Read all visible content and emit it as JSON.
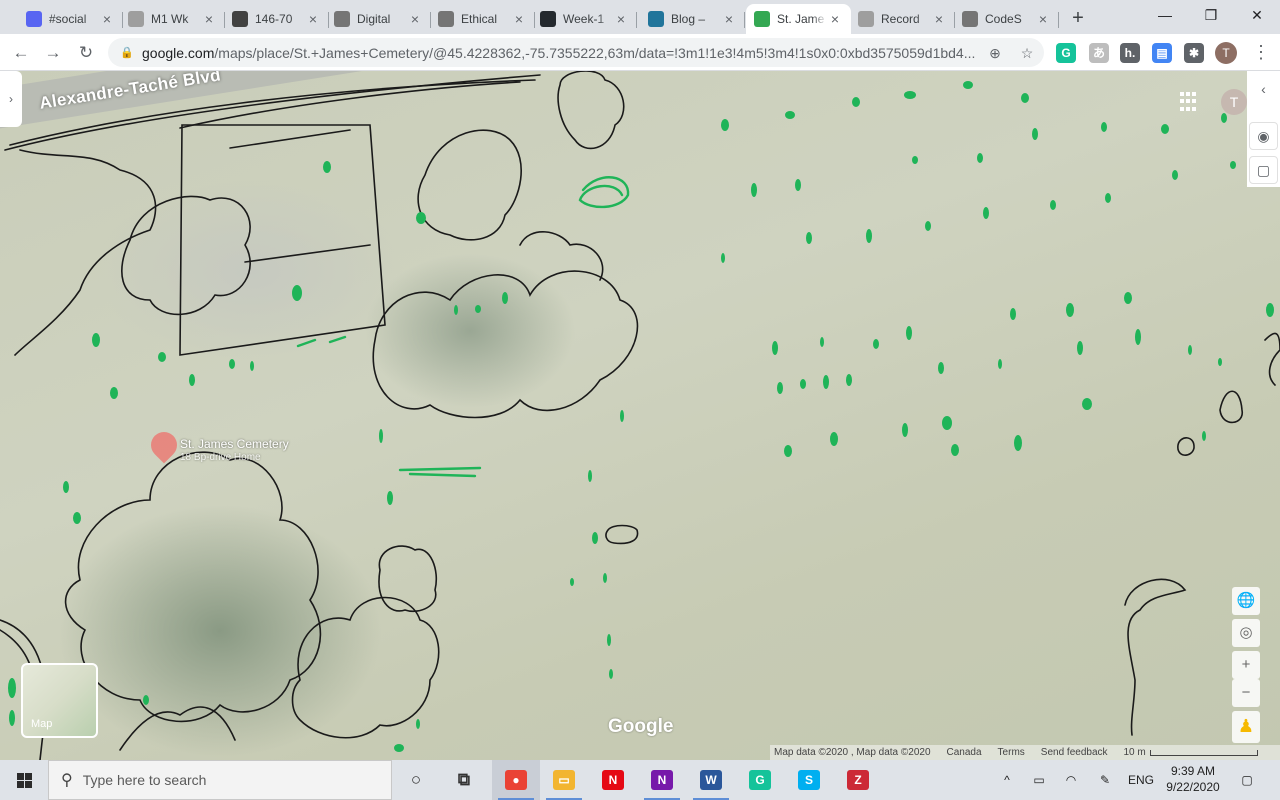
{
  "browser": {
    "tabs": [
      {
        "title": "#social",
        "favicon_color": "#5865f2",
        "active": false
      },
      {
        "title": "M1 Wk",
        "favicon_color": "#9e9e9e",
        "active": false
      },
      {
        "title": "146-70",
        "favicon_color": "#424242",
        "active": false
      },
      {
        "title": "Digital",
        "favicon_color": "#757575",
        "active": false
      },
      {
        "title": "Ethical",
        "favicon_color": "#757575",
        "active": false
      },
      {
        "title": "Week-1",
        "favicon_color": "#24292e",
        "active": false
      },
      {
        "title": "Blog –",
        "favicon_color": "#21759b",
        "active": false
      },
      {
        "title": "St. Jame",
        "favicon_color": "#34a853",
        "active": true
      },
      {
        "title": "Record",
        "favicon_color": "#9e9e9e",
        "active": false
      },
      {
        "title": "CodeS",
        "favicon_color": "#757575",
        "active": false
      }
    ],
    "new_tab_label": "+",
    "window_controls": {
      "minimize": "—",
      "restore": "❐",
      "close": "✕"
    },
    "nav": {
      "back": "←",
      "forward": "→",
      "reload": "↻"
    },
    "url_host": "google.com",
    "url_rest": "/maps/place/St.+James+Cemetery/@45.4228362,-75.7355222,63m/data=!3m1!1e3!4m5!3m4!1s0x0:0xbd3575059d1bd4...",
    "profile_initial": "T",
    "extensions": [
      {
        "name": "grammarly-icon",
        "label": "G",
        "color": "#15c39a"
      },
      {
        "name": "translate-icon",
        "label": "あ",
        "color": "#bdbdbd"
      },
      {
        "name": "hypothesis-icon",
        "label": "h.",
        "color": "#5f6368"
      },
      {
        "name": "docs-icon",
        "label": "▤",
        "color": "#4285f4"
      },
      {
        "name": "puzzle-icon",
        "label": "✱",
        "color": "#5f6368"
      }
    ]
  },
  "map": {
    "street_label": "Alexandre-Taché Blvd",
    "place_name": "St. James Cemetery",
    "place_subtitle": "18 Bp-drive Home",
    "account_initial": "T",
    "layer_thumb_label": "Map",
    "logo_text": "Google",
    "attribution": {
      "map_data": "Map data ©2020 , Map data ©2020",
      "country": "Canada",
      "terms": "Terms",
      "feedback": "Send feedback",
      "scale_label": "10 m"
    },
    "controls": {
      "globe": "🌐",
      "my_location": "◎",
      "zoom_in": "+",
      "zoom_out": "−",
      "pegman": "♟",
      "collapse": "‹",
      "expand": "›",
      "eye": "◉",
      "note": "▢"
    }
  },
  "taskbar": {
    "search_placeholder": "Type here to search",
    "search_icon": "⚲",
    "apps": [
      {
        "name": "cortana-icon",
        "label": "○",
        "color": "#333333",
        "open": false
      },
      {
        "name": "task-view-icon",
        "label": "⧉",
        "color": "#333333",
        "open": false
      },
      {
        "name": "chrome-icon",
        "label": "●",
        "color": "#ea4335",
        "open": true,
        "active": true
      },
      {
        "name": "file-explorer-icon",
        "label": "▭",
        "color": "#f2b530",
        "open": true
      },
      {
        "name": "netflix-icon",
        "label": "N",
        "color": "#e50914",
        "open": false
      },
      {
        "name": "onenote-icon",
        "label": "N",
        "color": "#7719aa",
        "open": true
      },
      {
        "name": "word-icon",
        "label": "W",
        "color": "#2b579a",
        "open": true
      },
      {
        "name": "grammarly-app-icon",
        "label": "G",
        "color": "#15c39a",
        "open": false
      },
      {
        "name": "skype-icon",
        "label": "S",
        "color": "#00aff0",
        "open": false
      },
      {
        "name": "zotero-icon",
        "label": "Z",
        "color": "#cc2936",
        "open": false
      }
    ],
    "tray": {
      "chevron": "^",
      "battery": "▭",
      "wifi": "◠",
      "pen": "✎",
      "language": "ENG",
      "notification": "▢"
    },
    "time": "9:39 AM",
    "date": "9/22/2020"
  }
}
